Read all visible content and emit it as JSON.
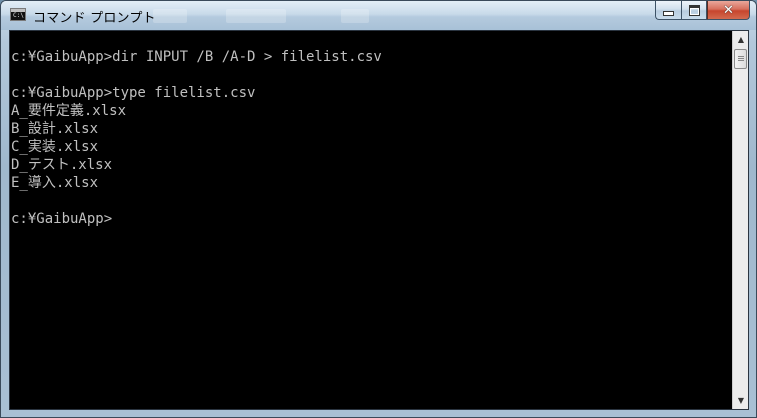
{
  "window": {
    "title": "コマンド プロンプト",
    "icon": "cmd-icon",
    "icon_text": "C:\\"
  },
  "caption_buttons": {
    "minimize": "minimize-icon",
    "maximize": "maximize-icon",
    "close": "close-icon",
    "close_glyph": "✕"
  },
  "console": {
    "lines": [
      "c:¥GaibuApp>dir INPUT /B /A-D > filelist.csv",
      "",
      "c:¥GaibuApp>type filelist.csv",
      "A_要件定義.xlsx",
      "B_設計.xlsx",
      "C_実装.xlsx",
      "D_テスト.xlsx",
      "E_導入.xlsx",
      "",
      "c:¥GaibuApp>"
    ]
  },
  "scrollbar": {
    "up_arrow": "▲",
    "down_arrow": "▼"
  },
  "colors": {
    "console_bg": "#000000",
    "console_fg": "#c0c0c0",
    "close_button": "#c7452d"
  }
}
